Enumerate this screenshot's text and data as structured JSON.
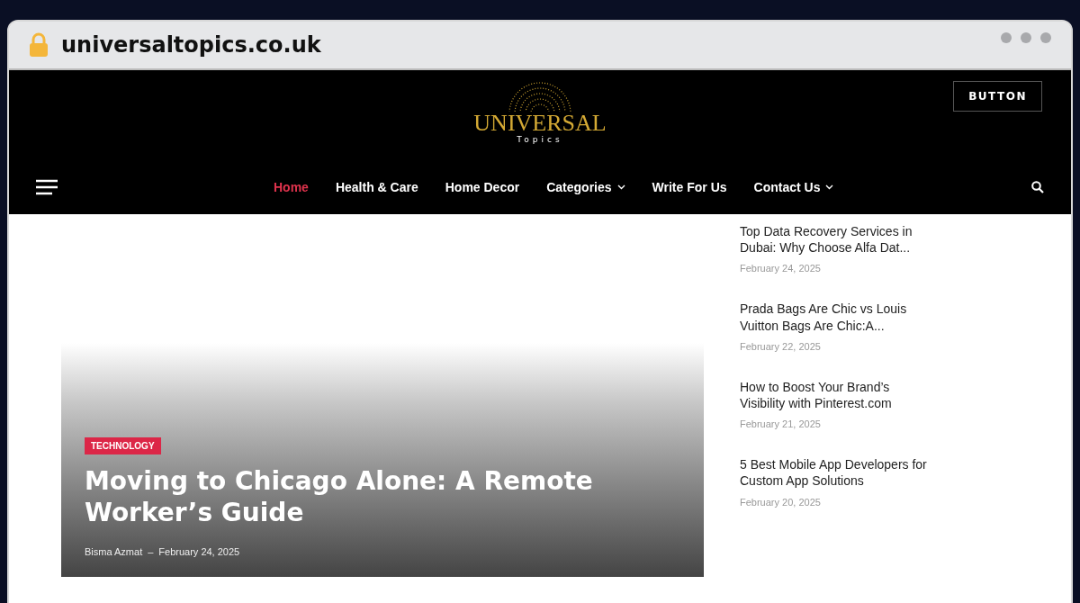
{
  "browser": {
    "url": "universaltopics.co.uk"
  },
  "header": {
    "logo": {
      "name": "UNIVERSAL",
      "tagline": "Topics"
    },
    "button": "BUTTON"
  },
  "nav": [
    {
      "label": "Home",
      "selected": true,
      "dropdown": false
    },
    {
      "label": "Health & Care",
      "selected": false,
      "dropdown": false
    },
    {
      "label": "Home Decor",
      "selected": false,
      "dropdown": false
    },
    {
      "label": "Categories",
      "selected": false,
      "dropdown": true
    },
    {
      "label": "Write For Us",
      "selected": false,
      "dropdown": false
    },
    {
      "label": "Contact Us",
      "selected": false,
      "dropdown": true
    }
  ],
  "featured": {
    "category": "TECHNOLOGY",
    "title": "Moving to Chicago Alone: A Remote Worker’s Guide",
    "author": "Bisma Azmat",
    "separator": "–",
    "date": "February 24, 2025"
  },
  "sidebar_posts": [
    {
      "title": "Top Data Recovery Services in Dubai: Why Choose Alfa Dat...",
      "date": "February 24, 2025"
    },
    {
      "title": "Prada Bags Are Chic  vs Louis Vuitton Bags Are Chic:A...",
      "date": "February 22, 2025"
    },
    {
      "title": "How to Boost Your Brand’s Visibility with Pinterest.com",
      "date": "February 21, 2025"
    },
    {
      "title": "5 Best Mobile App Developers for Custom App Solutions",
      "date": "February 20, 2025"
    }
  ]
}
